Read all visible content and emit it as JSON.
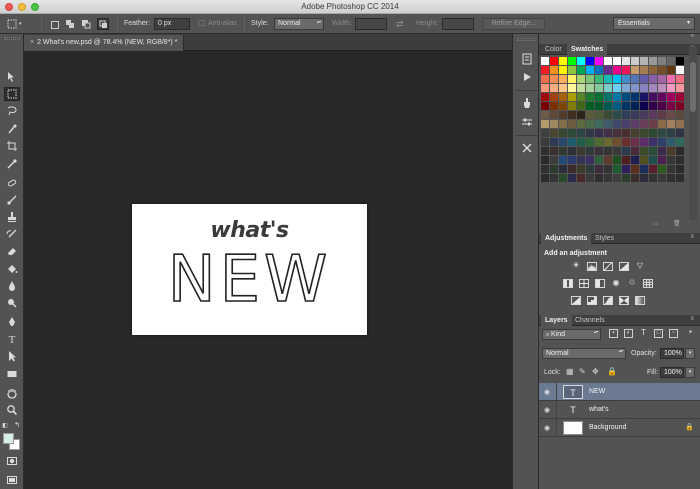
{
  "window": {
    "title": "Adobe Photoshop CC 2014"
  },
  "options_bar": {
    "feather_label": "Feather:",
    "feather_value": "0 px",
    "antialias_label": "Anti-alias",
    "style_label": "Style:",
    "style_value": "Normal",
    "width_label": "Width:",
    "height_label": "Height:",
    "refine_edge_label": "Refine Edge...",
    "workspace": "Essentials"
  },
  "document": {
    "tab_title": "2 What's new.psd @ 78.4% (NEW, RGB/8*) *",
    "close_symbol": "×",
    "art_line1": "what's",
    "art_line2": "NEW"
  },
  "swatches_panel": {
    "tabs": [
      {
        "label": "Color"
      },
      {
        "label": "Swatches"
      }
    ],
    "rows": [
      [
        "#ffffff",
        "#ff0000",
        "#ffff00",
        "#00ff00",
        "#00ffff",
        "#0000ff",
        "#ff00ff",
        "#ffffff",
        "#ffffff",
        "#e6e6e6",
        "#cccccc",
        "#b3b3b3",
        "#999999",
        "#808080",
        "#666666",
        "#000000"
      ],
      [
        "#ee1d24",
        "#f7941d",
        "#fff200",
        "#8dc63f",
        "#00a651",
        "#00aeef",
        "#0072bc",
        "#662d91",
        "#ec008c",
        "#ed145b",
        "#c69c6d",
        "#a67c52",
        "#8c6239",
        "#754c24",
        "#603913",
        "#ffffff"
      ],
      [
        "#f26c4f",
        "#f68e55",
        "#fbaf5c",
        "#fff467",
        "#acd372",
        "#7cc576",
        "#3bb878",
        "#1abbb4",
        "#00bff3",
        "#438ccb",
        "#5574b9",
        "#605ca8",
        "#855fa8",
        "#a763a8",
        "#f06ea9",
        "#f26d7d"
      ],
      [
        "#f7977a",
        "#f9ad81",
        "#fdc68a",
        "#fff79a",
        "#c4df9b",
        "#a3d39c",
        "#82ca9d",
        "#7bcdc8",
        "#6ecff6",
        "#7ea7d8",
        "#8493ca",
        "#8882be",
        "#a187be",
        "#bc8dbf",
        "#f49ac2",
        "#f6989d"
      ],
      [
        "#9e0b0f",
        "#a0410d",
        "#a36209",
        "#aba000",
        "#598527",
        "#1a7b30",
        "#007236",
        "#00746b",
        "#0076a3",
        "#004b80",
        "#003471",
        "#1b1464",
        "#440e62",
        "#630460",
        "#9e005d",
        "#9e0039"
      ],
      [
        "#790000",
        "#7b2e00",
        "#7d4900",
        "#827b00",
        "#406618",
        "#005e20",
        "#005826",
        "#005952",
        "#005b7f",
        "#003663",
        "#002157",
        "#0d004c",
        "#32004b",
        "#4b0049",
        "#7b0046",
        "#7a0026"
      ],
      [
        "#6b5a47",
        "#5e4a3b",
        "#4f3a2c",
        "#3e2f22",
        "#2f241a",
        "#5b5b3c",
        "#4a5a3a",
        "#3b4a33",
        "#2d4a4a",
        "#2e3e5a",
        "#3a3a5e",
        "#4a3a5e",
        "#5a3a5a",
        "#5e3a46",
        "#6b4a4a",
        "#5a4a3a"
      ],
      [
        "#b39b6b",
        "#9e8a5c",
        "#7f6f4a",
        "#6b5d3e",
        "#5c6b3e",
        "#4a6b4a",
        "#3e6b5c",
        "#3e5c6b",
        "#3e4a6b",
        "#4a3e6b",
        "#5c3e6b",
        "#6b3e5c",
        "#6b3e4a",
        "#8c6b4a",
        "#a08060",
        "#907050"
      ],
      [
        "#3f3f3f",
        "#4a4630",
        "#35482f",
        "#2f4838",
        "#2f4448",
        "#2f3748",
        "#372f48",
        "#442f48",
        "#482f3c",
        "#48302f",
        "#48402f",
        "#3b482f",
        "#2f4832",
        "#2f4843",
        "#2f3f48",
        "#2f3348"
      ],
      [
        "#3b3b3b",
        "#2e3a55",
        "#27476b",
        "#1e5c6b",
        "#215e4a",
        "#2f6338",
        "#4f6b2f",
        "#6b6b2f",
        "#6b4f2f",
        "#6b2f2f",
        "#6b2f4f",
        "#5c2f6b",
        "#3f2f6b",
        "#2f3f6b",
        "#2f5c6b",
        "#2f6b5c"
      ],
      [
        "#2f2f2f",
        "#3a3030",
        "#303a30",
        "#30303a",
        "#3a3a30",
        "#303a3a",
        "#3a303a",
        "#343434",
        "#383838",
        "#2b3b4b",
        "#4b2b3b",
        "#3b4b2b",
        "#2b4b3b",
        "#3b2b4b",
        "#4b3b2b",
        "#2b2b2b"
      ],
      [
        "#2a2a2a",
        "#3c3c3c",
        "#264a78",
        "#2d3a6b",
        "#343455",
        "#3a2f5e",
        "#2f5e3a",
        "#5e3a2f",
        "#1f4f1f",
        "#4f1f1f",
        "#1f1f4f",
        "#4f4f1f",
        "#1f4f4f",
        "#4f1f4f",
        "#383838",
        "#2e2e2e"
      ],
      [
        "#303030",
        "#2c3c2c",
        "#2c2c3c",
        "#3c2c2c",
        "#3c3c2c",
        "#2c3c3c",
        "#3c2c3c",
        "#323232",
        "#1e5a2e",
        "#2e1e5a",
        "#5a2e1e",
        "#1e2e5a",
        "#5a1e2e",
        "#2e5a1e",
        "#363636",
        "#2a2a2a"
      ],
      [
        "#2c2c2c",
        "#343434",
        "#2a4a2a",
        "#2a2a4a",
        "#4a2a2a",
        "#3a3a3a",
        "#2f2f2f",
        "#353535",
        "#3d3d3d",
        "#2c3d2c",
        "#3d2c2c",
        "#2c2c3d",
        "#333333",
        "#393939",
        "#303030",
        "#2d2d2d"
      ]
    ]
  },
  "adjustments_panel": {
    "tabs": [
      {
        "label": "Adjustments"
      },
      {
        "label": "Styles"
      }
    ],
    "title": "Add an adjustment"
  },
  "layers_panel": {
    "tabs": [
      {
        "label": "Layers"
      },
      {
        "label": "Channels"
      }
    ],
    "filter_kind": "Kind",
    "blend_mode": "Normal",
    "opacity_label": "Opacity:",
    "opacity_value": "100%",
    "lock_label": "Lock:",
    "fill_label": "Fill:",
    "fill_value": "100%",
    "layers": [
      {
        "name": "NEW",
        "type": "text",
        "selected": true
      },
      {
        "name": "what's",
        "type": "text",
        "selected": false
      },
      {
        "name": "Background",
        "type": "image",
        "selected": false,
        "locked": true
      }
    ]
  },
  "colors": {
    "foreground": "#d6efe6",
    "background": "#ffffff",
    "selected_layer": "#6b7a91"
  }
}
